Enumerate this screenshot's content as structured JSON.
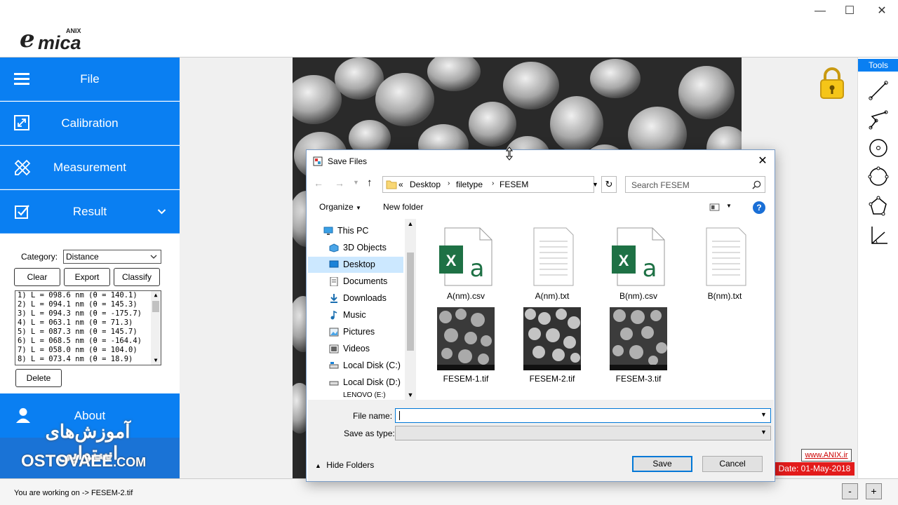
{
  "app": {
    "logo_main": "mica",
    "logo_prefix": "e",
    "logo_sup": "ANIX",
    "window_controls": {
      "minimize": "—",
      "maximize": "☐",
      "close": "✕"
    }
  },
  "sidebar": {
    "items": [
      {
        "label": "File"
      },
      {
        "label": "Calibration"
      },
      {
        "label": "Measurement"
      },
      {
        "label": "Result"
      }
    ],
    "result_panel": {
      "category_label": "Category:",
      "category_value": "Distance",
      "clear_label": "Clear",
      "export_label": "Export",
      "classify_label": "Classify",
      "delete_label": "Delete",
      "measurements": [
        "1) L = 098.6 nm  (θ = 140.1)",
        "2) L = 094.1 nm  (θ = 145.3)",
        "3) L = 094.3 nm  (θ = -175.7)",
        "4) L = 063.1 nm  (θ = 71.3)",
        "5) L = 087.3 nm  (θ = 145.7)",
        "6) L = 068.5 nm  (θ = -164.4)",
        "7) L = 058.0 nm  (θ = 104.0)",
        "8) L = 073.4 nm  (θ = 18.9)"
      ]
    },
    "about_label": "About",
    "watermark_fa": "آموزش‌های استوایی",
    "watermark_en": "OSTOVAEE",
    "watermark_tld": ".COM"
  },
  "tools": {
    "header": "Tools",
    "link": "www.ANIX.ir",
    "date": "Date: 01-May-2018"
  },
  "status": {
    "text": "You are working on -> FESEM-2.tif",
    "zoom_out": "-",
    "zoom_in": "+"
  },
  "dialog": {
    "title": "Save Files",
    "breadcrumb": [
      "«",
      "Desktop",
      "filetype",
      "FESEM"
    ],
    "search_placeholder": "Search FESEM",
    "organize_label": "Organize",
    "new_folder_label": "New folder",
    "help": "?",
    "nav_items": [
      {
        "label": "This PC",
        "icon": "pc-icon"
      },
      {
        "label": "3D Objects",
        "icon": "3d-objects-icon"
      },
      {
        "label": "Desktop",
        "icon": "desktop-icon",
        "selected": true
      },
      {
        "label": "Documents",
        "icon": "documents-icon"
      },
      {
        "label": "Downloads",
        "icon": "downloads-icon"
      },
      {
        "label": "Music",
        "icon": "music-icon"
      },
      {
        "label": "Pictures",
        "icon": "pictures-icon"
      },
      {
        "label": "Videos",
        "icon": "videos-icon"
      },
      {
        "label": "Local Disk (C:)",
        "icon": "disk-icon"
      },
      {
        "label": "Local Disk (D:)",
        "icon": "disk-icon"
      },
      {
        "label": "LENOVO (E:)",
        "icon": "disk-icon"
      }
    ],
    "files": [
      {
        "name": "A(nm).csv",
        "kind": "excel"
      },
      {
        "name": "A(nm).txt",
        "kind": "text"
      },
      {
        "name": "B(nm).csv",
        "kind": "excel"
      },
      {
        "name": "B(nm).txt",
        "kind": "text"
      },
      {
        "name": "FESEM-1.tif",
        "kind": "image"
      },
      {
        "name": "FESEM-2.tif",
        "kind": "image"
      },
      {
        "name": "FESEM-3.tif",
        "kind": "image"
      }
    ],
    "file_name_label": "File name:",
    "file_name_value": "",
    "save_type_label": "Save as type:",
    "save_type_value": "",
    "hide_folders_label": "Hide Folders",
    "save_label": "Save",
    "cancel_label": "Cancel",
    "colors": {
      "accent": "#0a7ff2",
      "excel": "#1e7145",
      "selection": "#cce8ff"
    }
  }
}
